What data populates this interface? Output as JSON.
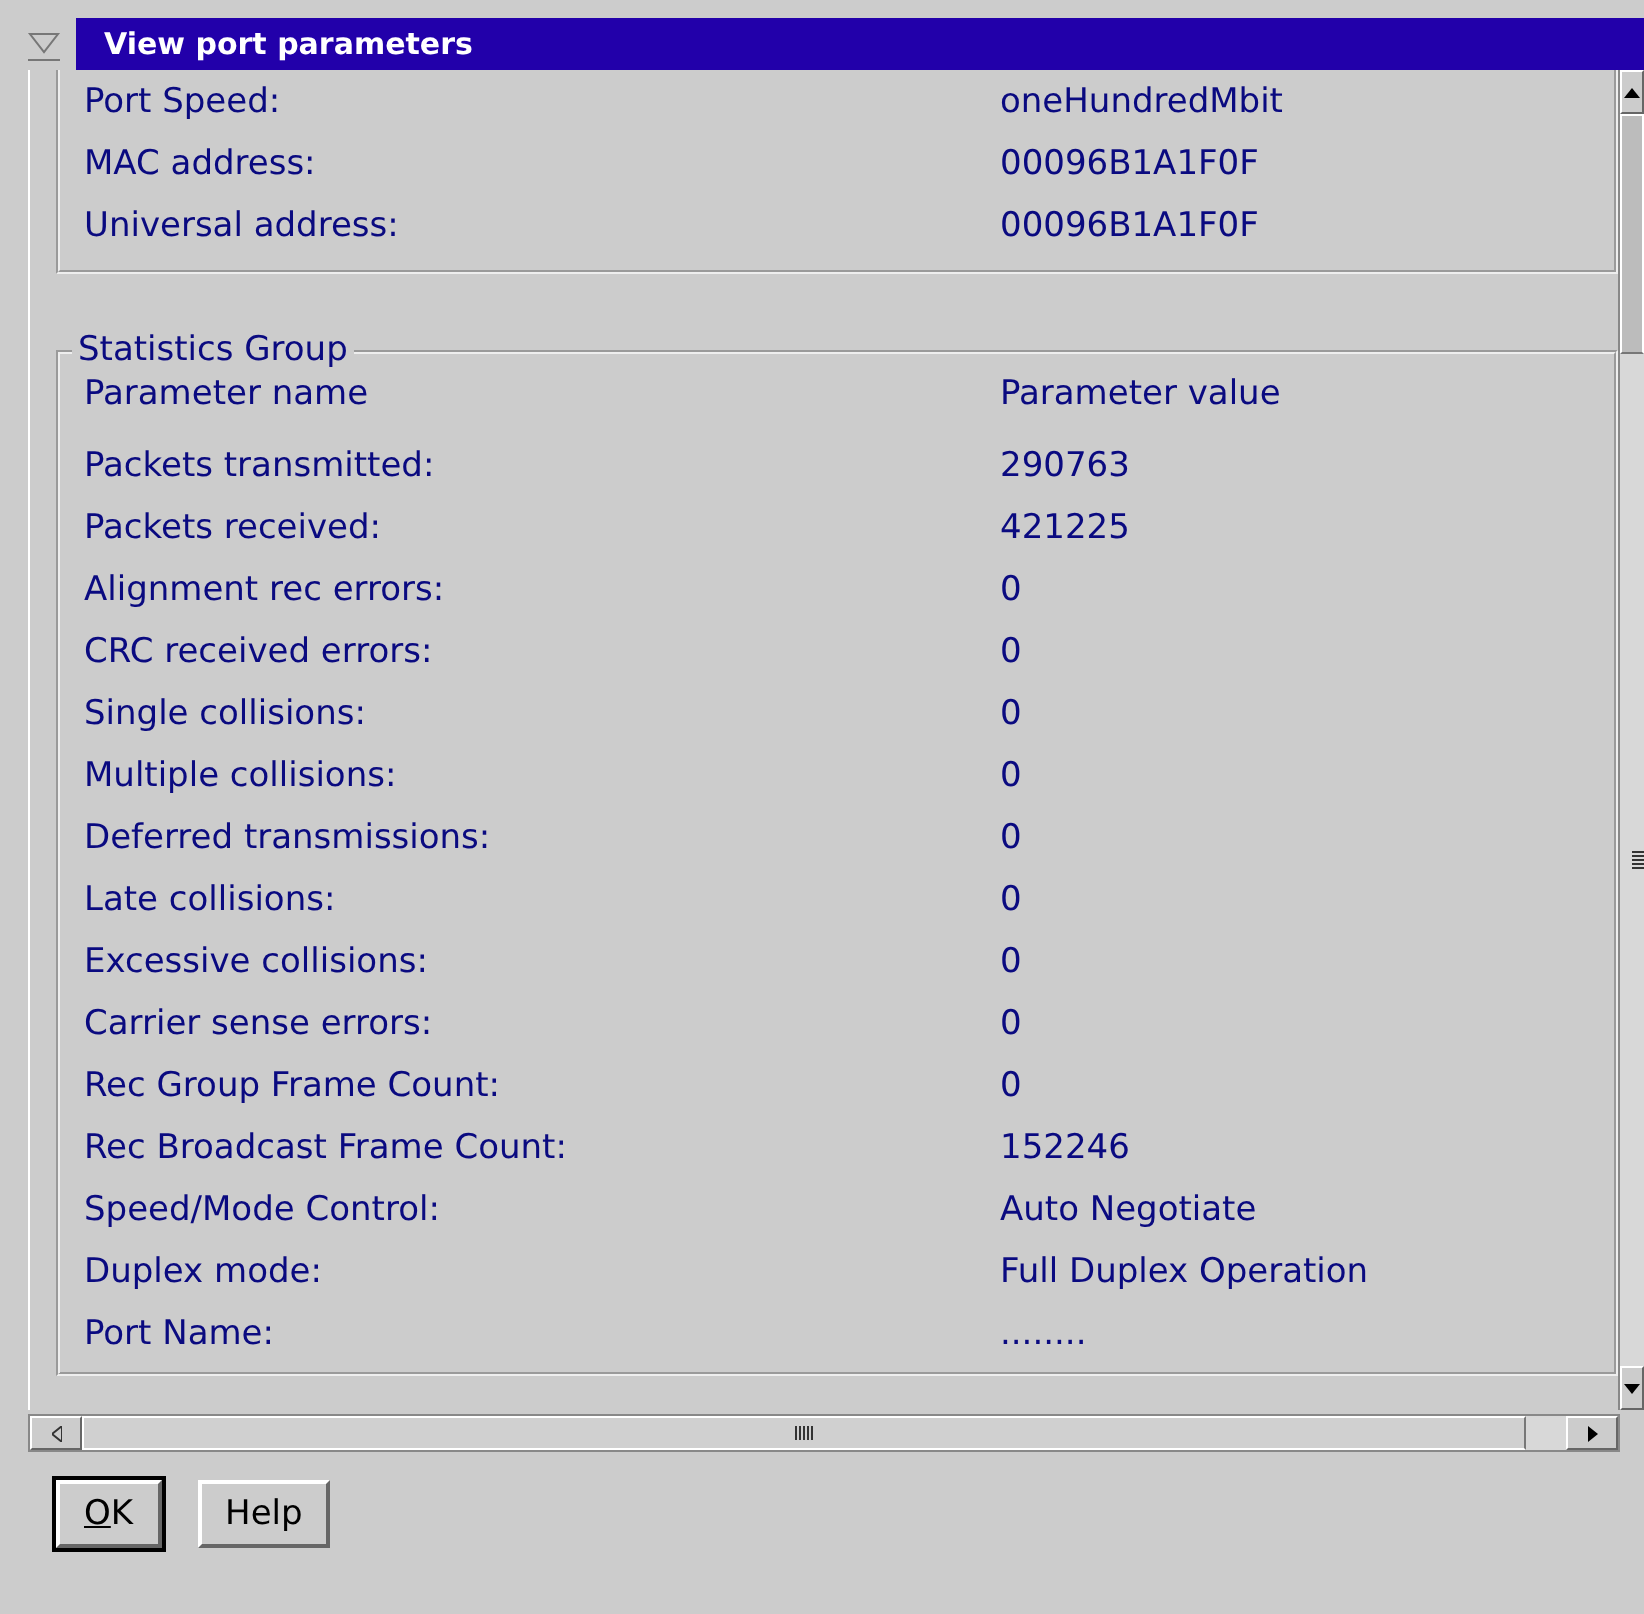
{
  "window": {
    "title": "View port parameters"
  },
  "port_group": {
    "rows": [
      {
        "label": "Port Speed:",
        "value": "oneHundredMbit"
      },
      {
        "label": "MAC address:",
        "value": "00096B1A1F0F"
      },
      {
        "label": "Universal address:",
        "value": "00096B1A1F0F"
      }
    ]
  },
  "statistics_group": {
    "title": "Statistics Group",
    "columns": [
      "Parameter name",
      "Parameter value"
    ],
    "rows": [
      {
        "label": "Packets transmitted:",
        "value": "290763"
      },
      {
        "label": "Packets received:",
        "value": "421225"
      },
      {
        "label": "Alignment rec errors:",
        "value": "0"
      },
      {
        "label": "CRC received errors:",
        "value": "0"
      },
      {
        "label": "Single collisions:",
        "value": "0"
      },
      {
        "label": "Multiple collisions:",
        "value": "0"
      },
      {
        "label": "Deferred transmissions:",
        "value": "0"
      },
      {
        "label": "Late collisions:",
        "value": "0"
      },
      {
        "label": "Excessive collisions:",
        "value": "0"
      },
      {
        "label": "Carrier sense errors:",
        "value": "0"
      },
      {
        "label": "Rec Group Frame Count:",
        "value": "0"
      },
      {
        "label": "Rec Broadcast Frame Count:",
        "value": "152246"
      },
      {
        "label": "Speed/Mode Control:",
        "value": "Auto Negotiate"
      },
      {
        "label": "Duplex mode:",
        "value": "Full Duplex Operation"
      },
      {
        "label": "Port Name:",
        "value": "........"
      }
    ]
  },
  "buttons": [
    "OK",
    "Help"
  ]
}
